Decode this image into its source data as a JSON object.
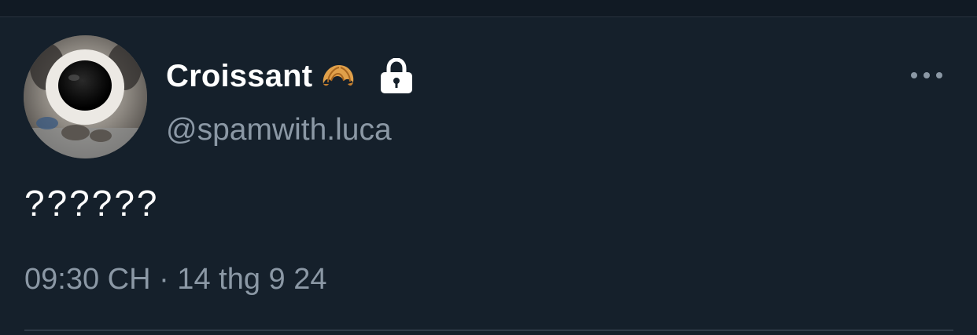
{
  "tweet": {
    "display_name": "Croissant",
    "handle": "@spamwith.luca",
    "text": "??????",
    "timestamp": "09:30 CH · 14 thg 9 24"
  },
  "icons": {
    "avatar": "raccoon-nose-closeup-avatar",
    "name_emoji": "croissant-icon",
    "protected": "lock-icon",
    "more": "more-horizontal-icon"
  },
  "colors": {
    "background": "#15202b",
    "primary_text": "#ffffff",
    "secondary_text": "#8b98a5",
    "divider": "#2f3b47"
  }
}
